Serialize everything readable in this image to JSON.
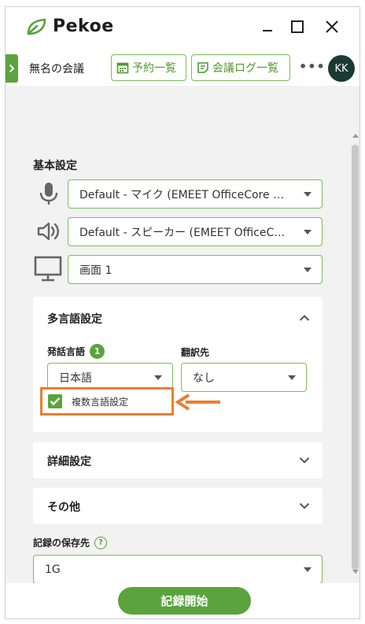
{
  "app": {
    "name": "Pekoe"
  },
  "header": {
    "meeting_name": "無名の会議",
    "reservations_label": "予約一覧",
    "logs_label": "会議ログ一覧",
    "more_label": "•••",
    "avatar_initials": "KK"
  },
  "basic": {
    "title": "基本設定",
    "mic_value": "Default - マイク (EMEET OfficeCore L…",
    "speaker_value": "Default - スピーカー (EMEET OfficeC…",
    "screen_value": "画面 1"
  },
  "multilang": {
    "title": "多言語設定",
    "speech_lang_label": "発話言語",
    "speech_lang_count": "1",
    "speech_lang_value": "日本語",
    "translate_label": "翻訳先",
    "translate_value": "なし",
    "multi_lang_checkbox_label": "複数言語設定",
    "multi_lang_checked": true
  },
  "details": {
    "title": "詳細設定"
  },
  "others": {
    "title": "その他"
  },
  "storage": {
    "label": "記録の保存先",
    "help": "?",
    "value": "1G"
  },
  "footer": {
    "start_label": "記録開始"
  },
  "colors": {
    "accent": "#5aa33d",
    "highlight": "#ed7d31",
    "avatar": "#1b3a34"
  }
}
